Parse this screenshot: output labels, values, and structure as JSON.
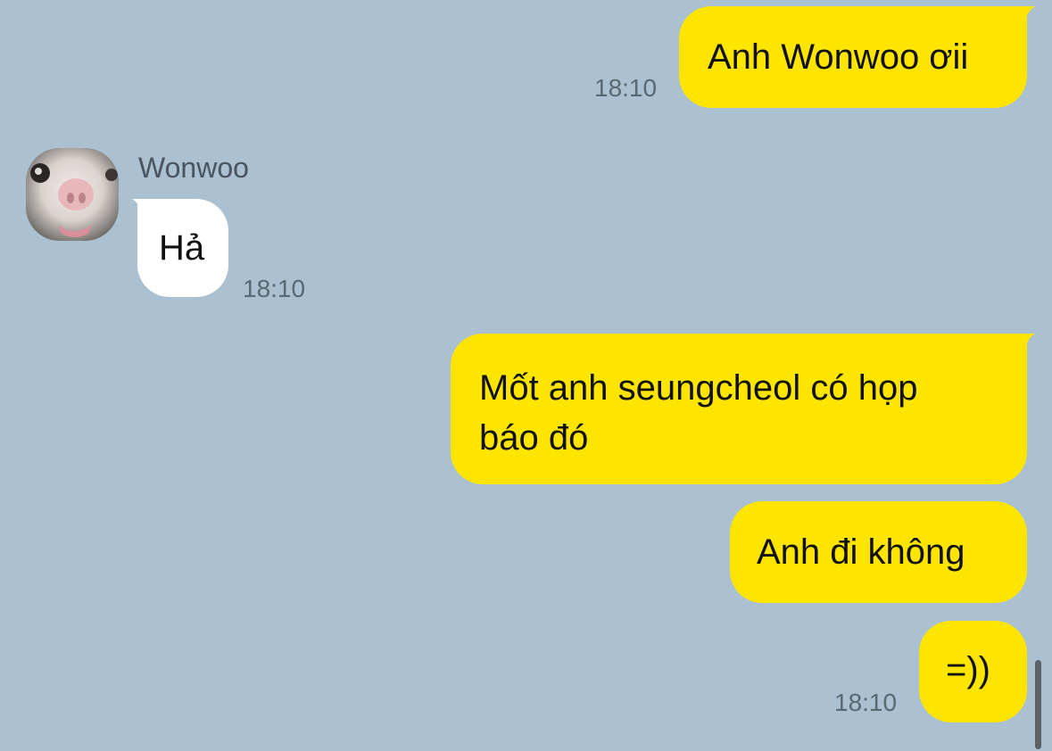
{
  "contact": {
    "name": "Wonwoo",
    "avatar": "cat-face-avatar"
  },
  "colors": {
    "background": "#abc1d1",
    "outgoing_bubble": "#fee500",
    "incoming_bubble": "#ffffff",
    "timestamp": "#5a6872"
  },
  "messages": [
    {
      "direction": "outgoing",
      "text": "Anh Wonwoo ơii",
      "time": "18:10"
    },
    {
      "direction": "incoming",
      "sender": "Wonwoo",
      "text": "Hả",
      "time": "18:10"
    },
    {
      "direction": "outgoing",
      "lines": [
        "Mốt anh seungcheol có họp",
        "báo đó"
      ]
    },
    {
      "direction": "outgoing",
      "text": "Anh đi không"
    },
    {
      "direction": "outgoing",
      "text": "=))",
      "time": "18:10"
    }
  ]
}
